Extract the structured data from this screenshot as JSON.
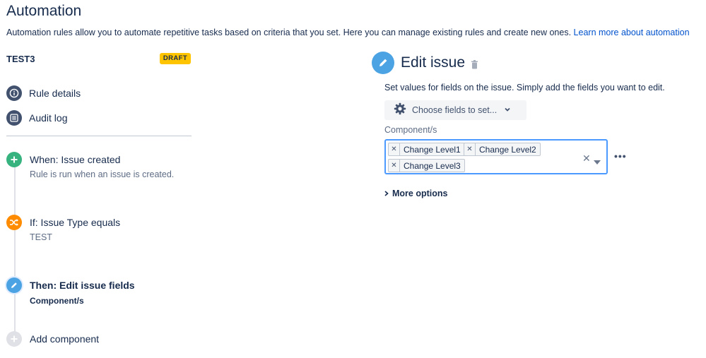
{
  "page": {
    "title": "Automation",
    "description": "Automation rules allow you to automate repetitive tasks based on criteria that you set. Here you can manage existing rules and create new ones.",
    "learn_more_link": "Learn more about automation"
  },
  "rule": {
    "name": "TEST3",
    "status_badge": "DRAFT"
  },
  "nav": {
    "items": [
      {
        "label": "Rule details",
        "icon": "info-icon"
      },
      {
        "label": "Audit log",
        "icon": "list-icon"
      }
    ]
  },
  "timeline": {
    "steps": [
      {
        "title": "When: Issue created",
        "subtitle": "Rule is run when an issue is created.",
        "icon": "plus-icon",
        "color": "#36b37e"
      },
      {
        "title": "If: Issue Type equals",
        "subtitle": "TEST",
        "icon": "shuffle-icon",
        "color": "#ff8b00"
      },
      {
        "title": "Then: Edit issue fields",
        "subtitle": "Component/s",
        "icon": "pencil-icon",
        "color": "#4ba3e3"
      }
    ],
    "add_component": "Add component"
  },
  "editor": {
    "title": "Edit issue",
    "description": "Set values for fields on the issue. Simply add the fields you want to edit.",
    "choose_fields_label": "Choose fields to set...",
    "field_label": "Component/s",
    "selected_values": [
      "Change Level1",
      "Change Level2",
      "Change Level3"
    ],
    "more_options": "More options"
  },
  "colors": {
    "accent": "#4ba3e3",
    "link": "#0052cc",
    "draft": "#ffc400",
    "focus_border": "#4c9aff"
  }
}
